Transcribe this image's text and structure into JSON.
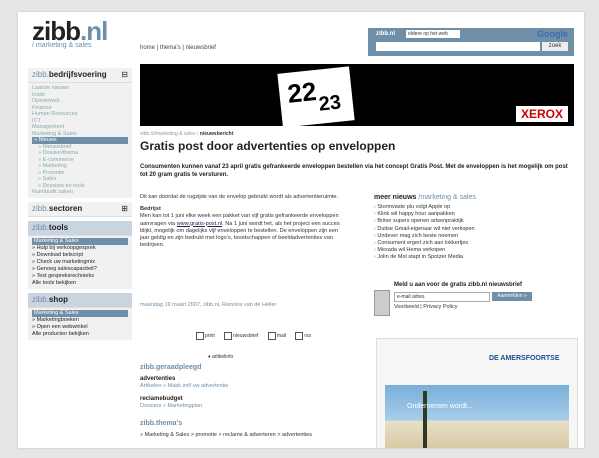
{
  "header": {
    "logo_main": "zibb",
    "logo_dot": ".nl",
    "tagline": "/ marketing & sales",
    "nav": "home | thema's | nieuwsbrief"
  },
  "search": {
    "label": "zibb.nl",
    "scope": "eldere op het web",
    "google": "Google",
    "button": "zoek"
  },
  "sidebar": {
    "bedrijfsvoering": {
      "title": "bedrijfsvoering",
      "items": [
        "Laatste nieuws",
        "Insite",
        "Opinie/web",
        "Finance",
        "Human Resources",
        "ICT",
        "Management",
        "Marketing & Sales"
      ],
      "selected": "» Nieuws",
      "subitems": [
        "» Nieuwsbrief",
        "» Dossier/thema",
        "» E-commerce",
        "» Marketing",
        "» Promotie",
        "» Sales",
        "» Dossiers en tools"
      ],
      "footer": "Ruimbudk zaken"
    },
    "sectoren": {
      "title": "sectoren"
    },
    "tools": {
      "title": "tools",
      "header": "Marketing & Sales",
      "items": [
        "» Hulp bij verkoopgesprek",
        "» Download belscript",
        "» Check uw marketingmix",
        "» Genoeg salescapaciteit?",
        "» Test gespreksrechnieks"
      ],
      "footer": "Alle tools bekijken"
    },
    "shop": {
      "title": "shop",
      "header": "Marketing & Sales",
      "items": [
        "» Marketingboeken",
        "» Open een webwinkel"
      ],
      "footer": "Alle producten bekijken"
    }
  },
  "banner": {
    "num1": "22",
    "num2": "23",
    "brand": "XEROX"
  },
  "article": {
    "breadcrumb_path": "zibb.nl/marketing & sales /",
    "breadcrumb_current": "nieuwsbericht",
    "title": "Gratis post door advertenties op enveloppen",
    "lead": "Consumenten kunnen vanaf 23 april gratis gefrankeerde enveloppen bestellen via het concept Gratis Post. Met de enveloppen is het mogelijk om post tot 20 gram gratis te versturen.",
    "p1": "Dit kan doordat de rugzijde van de envelop gebruikt wordt als advertentieruimte.",
    "h2": "Bedrijst",
    "p2a": "Men kan tot 1 juni elke week een pakket van vijf gratis gefrankeerde enveloppen aanvragen via ",
    "p2link": "www.gratis-post.nl",
    "p2b": ". Na 1 juni wordt het, als het project een succes blijkt, mogelijk om dagelijks vijf enveloppen te bestellen. De enveloppen zijn een jaar geldig en zijn bedrukt met logo's, boodschappen of beeldadvertenties van bedrijven.",
    "meta": "maandag 19 maart 2007, zibb.nl, Reinoire van de Heller"
  },
  "actions": {
    "print": "print",
    "nieuwsbrief": "nieuwsbrief",
    "mail": "mail",
    "rss": "rss",
    "reacties": "♦ artikelinfo"
  },
  "geraadpleegd": {
    "title": "zibb.geraadpleegd",
    "adv_title": "advertenties",
    "adv_links": "Artikelen  »  Maak zelf uw advertentie",
    "budget_title": "reclamebudget",
    "budget_links": "Dossiers  »  Marketingplan"
  },
  "themas": {
    "title": "zibb.thema's",
    "text": "» Marketing & Sales > promotie > reclame & adverteren > advertenties"
  },
  "meer": {
    "title": "meer nieuws",
    "section": "/marketing & sales",
    "items": [
      "Stormvaste plu volgt Apple op",
      "Klink wil happy hour aanpakken",
      "Britse supers openen artsenpraktijk",
      "Duitse Gmail-eigenaar wil niet verkopen",
      "Undever mag zich beste noemen",
      "Consument ergert zich aan lokkertjes",
      "Mexada wil Hema verkopen",
      "Jolin de Mol stapt in Spotzer Media"
    ]
  },
  "newsletter": {
    "title": "Meld u aan voor de gratis zibb.nl nieuwsbrief",
    "placeholder": "e-mail adres",
    "button": "Aanmelden »",
    "links": "Voorbeeld | Privacy Policy"
  },
  "ad": {
    "logo": "DE AMERSFOORTSE",
    "caption": "Ondernemen wordt..."
  },
  "colors": {
    "accent": "#6f8ea8",
    "banner_bg": "#000000",
    "xerox_red": "#cc0000"
  }
}
